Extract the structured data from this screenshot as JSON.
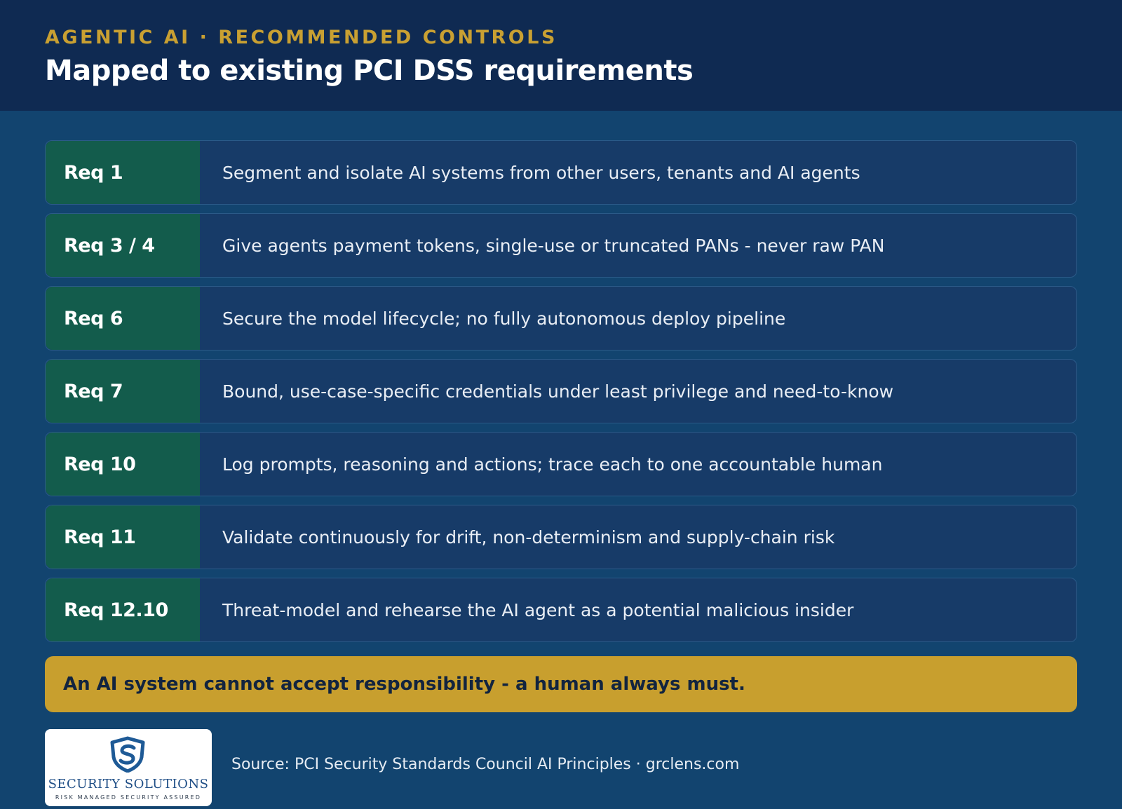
{
  "header": {
    "eyebrow": "AGENTIC AI · RECOMMENDED CONTROLS",
    "title": "Mapped to existing PCI DSS requirements"
  },
  "requirements": [
    {
      "label": "Req 1",
      "text": "Segment and isolate AI systems from other users, tenants and AI agents"
    },
    {
      "label": "Req 3 / 4",
      "text": "Give agents payment tokens, single-use or truncated PANs - never raw PAN"
    },
    {
      "label": "Req 6",
      "text": "Secure the model lifecycle; no fully autonomous deploy pipeline"
    },
    {
      "label": "Req 7",
      "text": "Bound, use-case-specific credentials under least privilege and need-to-know"
    },
    {
      "label": "Req 10",
      "text": "Log prompts, reasoning and actions; trace each to one accountable human"
    },
    {
      "label": "Req 11",
      "text": "Validate continuously for drift, non-determinism and supply-chain risk"
    },
    {
      "label": "Req 12.10",
      "text": "Threat-model and rehearse the AI agent as a potential malicious insider"
    }
  ],
  "callout": {
    "text": "An AI system cannot accept responsibility - a human always must."
  },
  "footer": {
    "logo_name": "SECURITY SOLUTIONS",
    "logo_tagline": "RISK MANAGED SECURITY ASSURED",
    "source": "Source: PCI Security Standards Council AI Principles · grclens.com"
  },
  "colors": {
    "header_bg": "#0f2a52",
    "page_bg": "#12446f",
    "accent_gold": "#c9a032",
    "badge_green": "#135c4c",
    "row_bg": "#173b68"
  }
}
